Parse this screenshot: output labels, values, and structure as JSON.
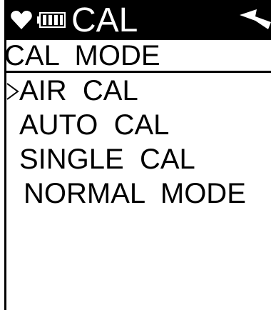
{
  "status_bar": {
    "title": "CAL",
    "icons": [
      "heart-icon",
      "battery-icon",
      "signal-icon"
    ]
  },
  "mode_header": {
    "label": "CAL  MODE"
  },
  "menu": {
    "selected_index": 0,
    "selector_icon": "chevron-right-icon",
    "items": [
      {
        "label": "AIR  CAL"
      },
      {
        "label": "AUTO  CAL"
      },
      {
        "label": "SINGLE  CAL"
      },
      {
        "label": "NORMAL  MODE"
      }
    ]
  },
  "colors": {
    "background": "#ffffff",
    "foreground": "#000000"
  }
}
